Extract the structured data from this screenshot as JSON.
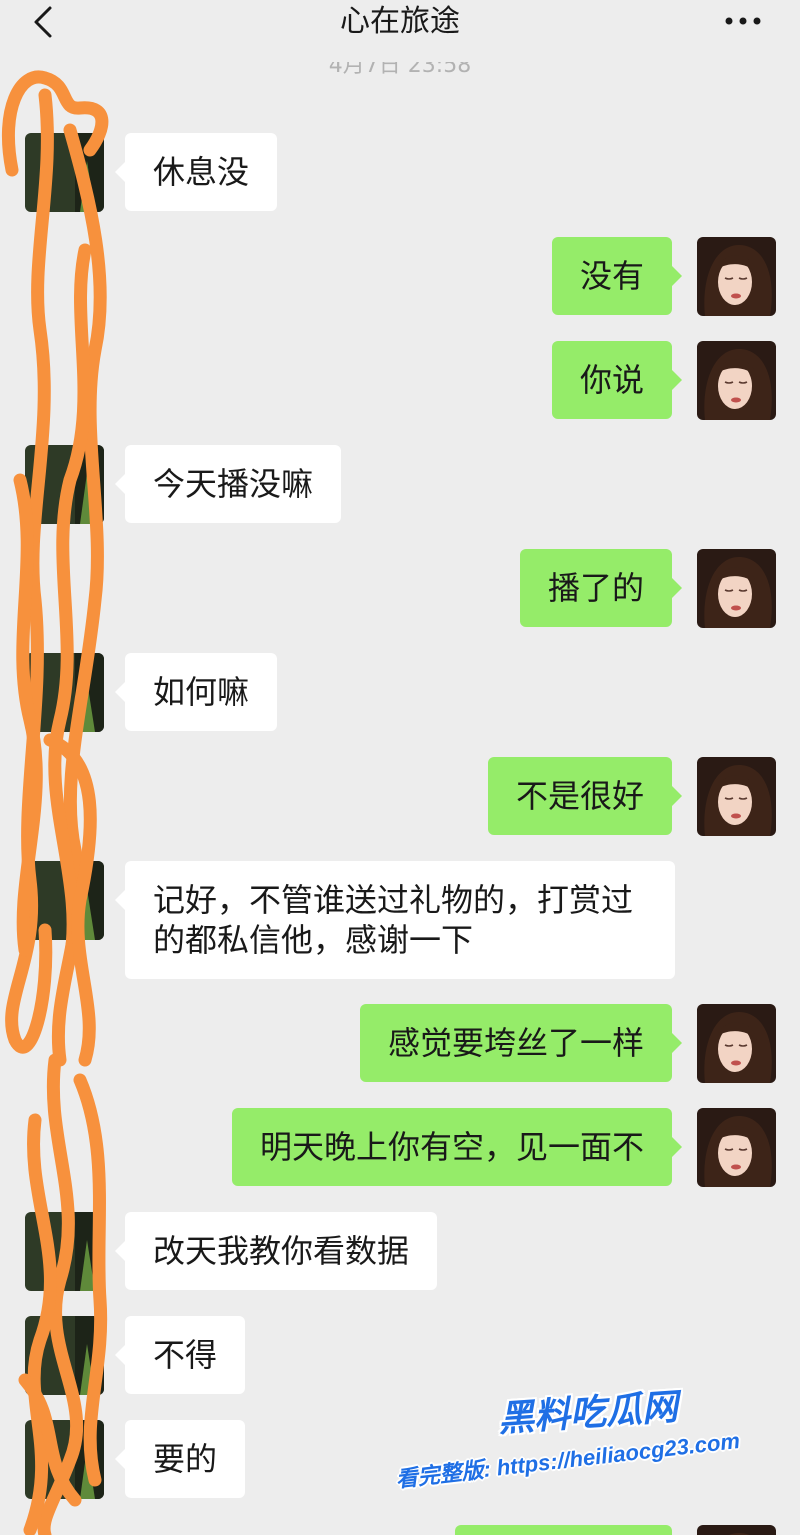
{
  "header": {
    "title": "心在旅途",
    "back_icon": "chevron-left-icon",
    "more_icon": "more-dots-icon"
  },
  "timestamp": "4月7日 23:58",
  "messages": [
    {
      "sender": "contact",
      "text": "休息没"
    },
    {
      "sender": "self",
      "text": "没有"
    },
    {
      "sender": "self",
      "text": "你说"
    },
    {
      "sender": "contact",
      "text": "今天播没嘛"
    },
    {
      "sender": "self",
      "text": "播了的"
    },
    {
      "sender": "contact",
      "text": "如何嘛"
    },
    {
      "sender": "self",
      "text": "不是很好"
    },
    {
      "sender": "contact",
      "text": "记好，不管谁送过礼物的，打赏过的都私信他，感谢一下"
    },
    {
      "sender": "self",
      "text": "感觉要垮丝了一样"
    },
    {
      "sender": "self",
      "text": "明天晚上你有空，见一面不"
    },
    {
      "sender": "contact",
      "text": "改天我教你看数据"
    },
    {
      "sender": "contact",
      "text": "不得"
    },
    {
      "sender": "contact",
      "text": "要的"
    },
    {
      "sender": "self"
    }
  ],
  "watermark": {
    "brand": "黑料吃瓜网",
    "promo": "看完整版: https://heiliaocg23.com"
  },
  "colors": {
    "background": "#EDEDED",
    "incoming_bubble": "#FFFFFF",
    "outgoing_bubble": "#95EC69",
    "text": "#191919",
    "redaction": "#F7913D",
    "watermark": "#1F6FE5"
  }
}
